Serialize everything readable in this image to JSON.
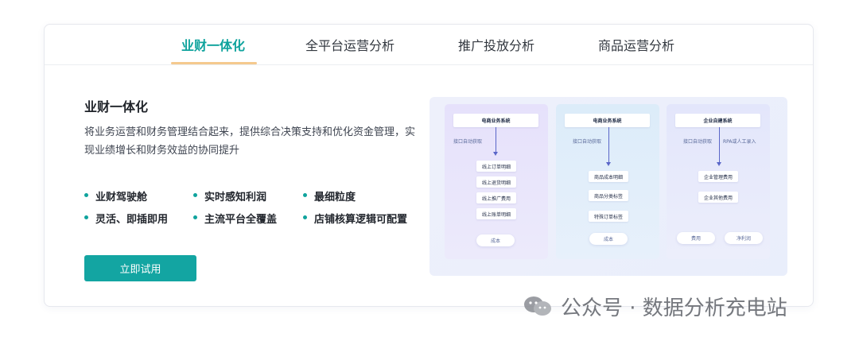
{
  "tabs": [
    {
      "label": "业财一体化",
      "active": true
    },
    {
      "label": "全平台运营分析",
      "active": false
    },
    {
      "label": "推广投放分析",
      "active": false
    },
    {
      "label": "商品运营分析",
      "active": false
    }
  ],
  "content": {
    "title": "业财一体化",
    "description": "将业务运营和财务管理结合起来，提供综合决策支持和优化资金管理，实现业绩增长和财务效益的协同提升",
    "features": [
      "业财驾驶舱",
      "实时感知利润",
      "最细粒度",
      "灵活、即插即用",
      "主流平台全覆盖",
      "店铺核算逻辑可配置"
    ],
    "cta_label": "立即试用"
  },
  "diagram": {
    "columns": [
      {
        "title": "电商业务系统",
        "arrow_labels": [
          "接口自动获取"
        ],
        "items": [
          "线上订单明细",
          "线上退货明细",
          "线上推广费用",
          "线上账单明细"
        ],
        "pills": [
          "成本"
        ]
      },
      {
        "title": "电商业务系统",
        "arrow_labels": [
          "接口自动获取"
        ],
        "items": [
          "商品成本明细",
          "商品分类标签",
          "特殊订单标签"
        ],
        "pills": [
          "成本"
        ]
      },
      {
        "title": "企业自建系统",
        "arrow_labels": [
          "接口自动获取",
          "RPA或人工录入"
        ],
        "items": [
          "企业管理费用",
          "企业其他费用"
        ],
        "pills": [
          "费用",
          "净利润"
        ]
      }
    ]
  },
  "watermark": {
    "text": "公众号 · 数据分析充电站",
    "icon": "wechat-icon"
  },
  "colors": {
    "accent": "#13a5a2",
    "tab_underline": "#f5c98e",
    "diagram_arrow": "#5a66c8"
  }
}
